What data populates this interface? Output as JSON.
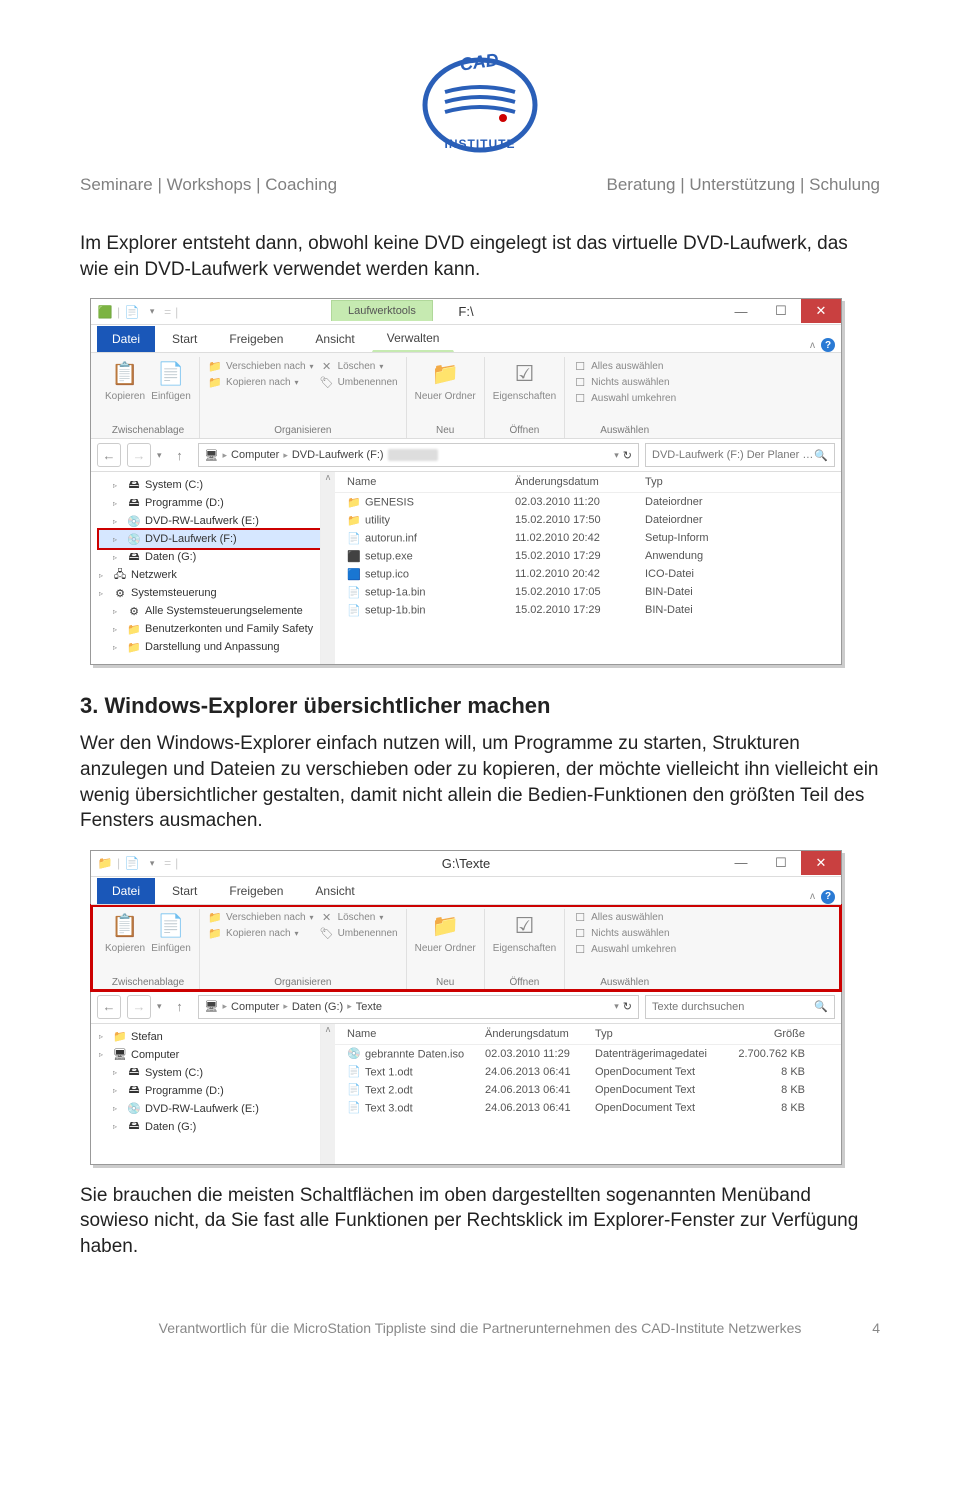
{
  "header": {
    "left": [
      "Seminare",
      "Workshops",
      "Coaching"
    ],
    "right": [
      "Beratung",
      "Unterstützung",
      "Schulung"
    ]
  },
  "para1": "Im Explorer entsteht dann, obwohl keine DVD eingelegt ist das virtuelle DVD-Laufwerk, das wie ein DVD-Laufwerk verwendet werden kann.",
  "heading2": "3. Windows-Explorer übersichtlicher machen",
  "para2": "Wer den Windows-Explorer einfach nutzen will, um Programme zu starten, Strukturen anzulegen und Dateien zu verschieben oder zu kopieren, der möchte vielleicht ihn vielleicht ein wenig übersichtlicher gestalten, damit nicht allein die Bedien-Funktionen den größten Teil des Fensters ausmachen.",
  "para3": "Sie brauchen die meisten Schaltflächen im oben dargestellten sogenannten Menüband sowieso nicht, da Sie fast alle Funktionen per Rechtsklick im Explorer-Fenster zur Verfügung haben.",
  "win1": {
    "drive_tools": "Laufwerktools",
    "title": "F:\\",
    "tabs": [
      "Datei",
      "Start",
      "Freigeben",
      "Ansicht",
      "Verwalten"
    ],
    "ribbon": {
      "g1": {
        "copy": "Kopieren",
        "paste": "Einfügen",
        "label": "Zwischenablage"
      },
      "g2": {
        "move": "Verschieben nach",
        "copy": "Kopieren nach",
        "del": "Löschen",
        "rename": "Umbenennen",
        "label": "Organisieren"
      },
      "g3": {
        "new": "Neuer Ordner",
        "label": "Neu"
      },
      "g4": {
        "props": "Eigenschaften",
        "label": "Öffnen"
      },
      "g5": {
        "all": "Alles auswählen",
        "none": "Nichts auswählen",
        "invert": "Auswahl umkehren",
        "label": "Auswählen"
      }
    },
    "breadcrumb": [
      "Computer",
      "DVD-Laufwerk (F:)"
    ],
    "search": "DVD-Laufwerk (F:) Der Planer …",
    "tree": [
      {
        "indent": 1,
        "label": "System (C:)"
      },
      {
        "indent": 1,
        "label": "Programme (D:)"
      },
      {
        "indent": 1,
        "label": "DVD-RW-Laufwerk (E:)"
      },
      {
        "indent": 1,
        "label": "DVD-Laufwerk (F:)",
        "sel": true
      },
      {
        "indent": 1,
        "label": "Daten (G:)"
      },
      {
        "indent": 0,
        "label": "Netzwerk"
      },
      {
        "indent": 0,
        "label": "Systemsteuerung"
      },
      {
        "indent": 1,
        "label": "Alle Systemsteuerungselemente"
      },
      {
        "indent": 1,
        "label": "Benutzerkonten und Family Safety"
      },
      {
        "indent": 1,
        "label": "Darstellung und Anpassung"
      }
    ],
    "columns": {
      "name": "Name",
      "date": "Änderungsdatum",
      "type": "Typ"
    },
    "files": [
      {
        "icon": "📁",
        "name": "GENESIS",
        "date": "02.03.2010 11:20",
        "type": "Dateiordner"
      },
      {
        "icon": "📁",
        "name": "utility",
        "date": "15.02.2010 17:50",
        "type": "Dateiordner"
      },
      {
        "icon": "📄",
        "name": "autorun.inf",
        "date": "11.02.2010 20:42",
        "type": "Setup-Inform"
      },
      {
        "icon": "⬛",
        "name": "setup.exe",
        "date": "15.02.2010 17:29",
        "type": "Anwendung"
      },
      {
        "icon": "🟦",
        "name": "setup.ico",
        "date": "11.02.2010 20:42",
        "type": "ICO-Datei"
      },
      {
        "icon": "📄",
        "name": "setup-1a.bin",
        "date": "15.02.2010 17:05",
        "type": "BIN-Datei"
      },
      {
        "icon": "📄",
        "name": "setup-1b.bin",
        "date": "15.02.2010 17:29",
        "type": "BIN-Datei"
      }
    ]
  },
  "win2": {
    "title": "G:\\Texte",
    "tabs": [
      "Datei",
      "Start",
      "Freigeben",
      "Ansicht"
    ],
    "ribbon": {
      "g1": {
        "copy": "Kopieren",
        "paste": "Einfügen",
        "label": "Zwischenablage"
      },
      "g2": {
        "move": "Verschieben nach",
        "copy": "Kopieren nach",
        "del": "Löschen",
        "rename": "Umbenennen",
        "label": "Organisieren"
      },
      "g3": {
        "new": "Neuer Ordner",
        "label": "Neu"
      },
      "g4": {
        "props": "Eigenschaften",
        "label": "Öffnen"
      },
      "g5": {
        "all": "Alles auswählen",
        "none": "Nichts auswählen",
        "invert": "Auswahl umkehren",
        "label": "Auswählen"
      }
    },
    "breadcrumb": [
      "Computer",
      "Daten (G:)",
      "Texte"
    ],
    "search": "Texte durchsuchen",
    "tree": [
      {
        "indent": 0,
        "label": "Stefan"
      },
      {
        "indent": 0,
        "label": "Computer"
      },
      {
        "indent": 1,
        "label": "System (C:)"
      },
      {
        "indent": 1,
        "label": "Programme (D:)"
      },
      {
        "indent": 1,
        "label": "DVD-RW-Laufwerk (E:)"
      },
      {
        "indent": 1,
        "label": "Daten (G:)"
      }
    ],
    "columns": {
      "name": "Name",
      "date": "Änderungsdatum",
      "type": "Typ",
      "size": "Größe"
    },
    "files": [
      {
        "icon": "💿",
        "name": "gebrannte Daten.iso",
        "date": "02.03.2010 11:29",
        "type": "Datenträgerimagedatei",
        "size": "2.700.762 KB"
      },
      {
        "icon": "📄",
        "name": "Text 1.odt",
        "date": "24.06.2013 06:41",
        "type": "OpenDocument Text",
        "size": "8 KB"
      },
      {
        "icon": "📄",
        "name": "Text 2.odt",
        "date": "24.06.2013 06:41",
        "type": "OpenDocument Text",
        "size": "8 KB"
      },
      {
        "icon": "📄",
        "name": "Text 3.odt",
        "date": "24.06.2013 06:41",
        "type": "OpenDocument Text",
        "size": "8 KB"
      }
    ]
  },
  "footer": {
    "text": "Verantwortlich für die MicroStation Tippliste sind die Partnerunternehmen des CAD-Institute Netzwerkes",
    "page": "4"
  }
}
